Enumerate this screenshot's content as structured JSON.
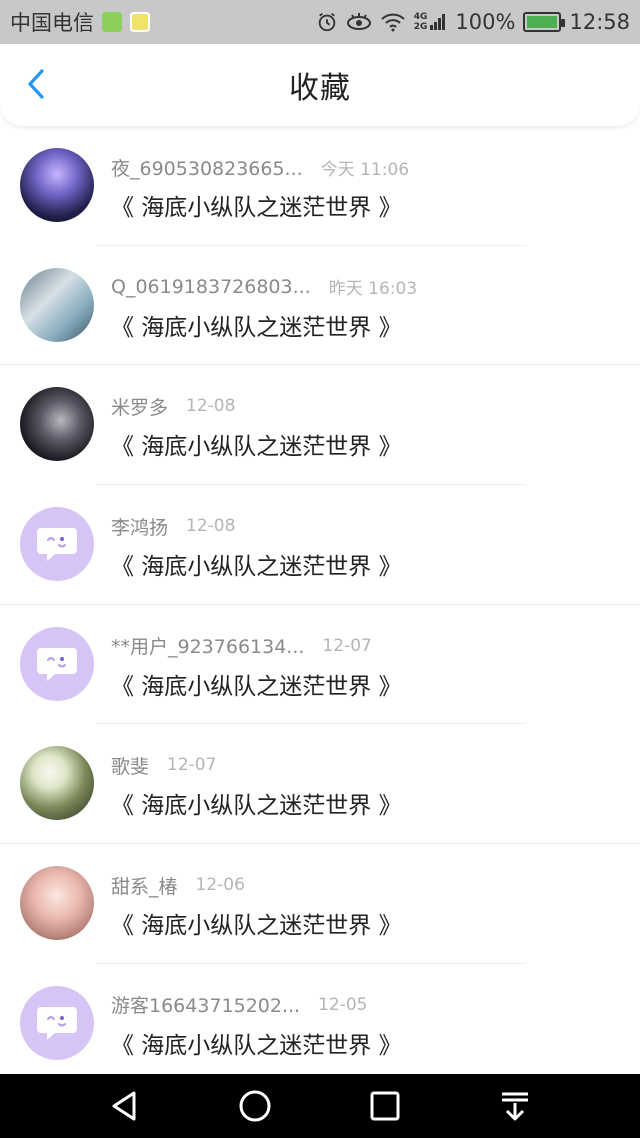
{
  "status_bar": {
    "carrier": "中国电信",
    "network_top": "4G",
    "network_bottom": "2G",
    "battery_level": 100,
    "battery": "100%",
    "time": "12:58"
  },
  "header": {
    "title": "收藏",
    "back_icon": "chevron-left-icon"
  },
  "favorites": [
    {
      "user": "夜_690530823665...",
      "time": "今天 11:06",
      "title": "《 海底小纵队之迷茫世界 》",
      "avatar": "photo"
    },
    {
      "user": "Q_0619183726803...",
      "time": "昨天 16:03",
      "title": "《 海底小纵队之迷茫世界 》",
      "avatar": "photo"
    },
    {
      "user": "米罗多",
      "time": "12-08",
      "title": "《 海底小纵队之迷茫世界 》",
      "avatar": "photo"
    },
    {
      "user": "李鸿扬",
      "time": "12-08",
      "title": "《 海底小纵队之迷茫世界 》",
      "avatar": "default"
    },
    {
      "user": "**用户_923766134...",
      "time": "12-07",
      "title": "《 海底小纵队之迷茫世界 》",
      "avatar": "default"
    },
    {
      "user": "歌斐",
      "time": "12-07",
      "title": "《 海底小纵队之迷茫世界 》",
      "avatar": "photo"
    },
    {
      "user": "甜系_椿",
      "time": "12-06",
      "title": "《 海底小纵队之迷茫世界 》",
      "avatar": "photo"
    },
    {
      "user": "游客16643715202...",
      "time": "12-05",
      "title": "《 海底小纵队之迷茫世界 》",
      "avatar": "default"
    }
  ],
  "colors": {
    "accent": "#2196f3",
    "default_avatar": "#d5c4f5",
    "battery": "#4caf50"
  },
  "nav_bar": {
    "icons": [
      "back-triangle-icon",
      "home-circle-icon",
      "recents-square-icon",
      "notification-pulldown-icon"
    ]
  }
}
